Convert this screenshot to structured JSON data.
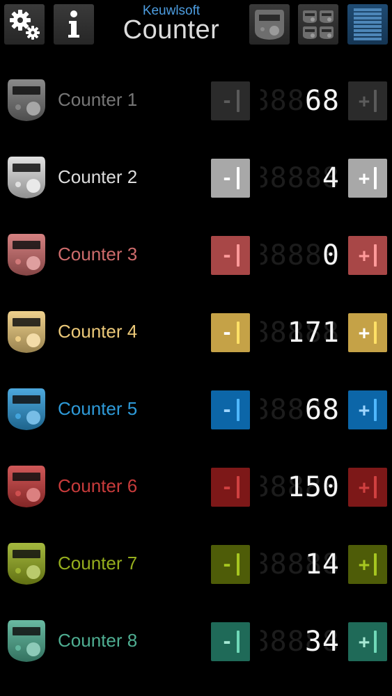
{
  "header": {
    "brand": "Keuwlsoft",
    "title": "Counter"
  },
  "toolbar": {
    "buttons": [
      {
        "icon": "gears-icon"
      },
      {
        "icon": "info-icon"
      },
      {
        "icon": "single-counter-icon"
      },
      {
        "icon": "multi-counter-icon"
      },
      {
        "icon": "list-icon"
      }
    ]
  },
  "counters": [
    {
      "name": "Counter 1",
      "value": "68",
      "color": "#777777",
      "button_color": "#2b2b2b",
      "bar_color": "#5a5a5a",
      "sign_color": "#5c5c5c"
    },
    {
      "name": "Counter 2",
      "value": "4",
      "color": "#dddddd",
      "button_color": "#a8a8a8",
      "bar_color": "#ffffff",
      "sign_color": "#ffffff"
    },
    {
      "name": "Counter 3",
      "value": "0",
      "color": "#cd6b6b",
      "button_color": "#a84747",
      "bar_color": "#ff9a9a",
      "sign_color": "#ff9a9a"
    },
    {
      "name": "Counter 4",
      "value": "171",
      "color": "#ecc979",
      "button_color": "#c5a247",
      "bar_color": "#ffe066",
      "sign_color": "#ffffff"
    },
    {
      "name": "Counter 5",
      "value": "68",
      "color": "#2e9ad8",
      "button_color": "#0c66a8",
      "bar_color": "#4fb8ff",
      "sign_color": "#9fd6ff"
    },
    {
      "name": "Counter 6",
      "value": "150",
      "color": "#c83b3b",
      "button_color": "#7d1818",
      "bar_color": "#d04040",
      "sign_color": "#d04040"
    },
    {
      "name": "Counter 7",
      "value": "14",
      "color": "#95ad1d",
      "button_color": "#4e5c08",
      "bar_color": "#a6c620",
      "sign_color": "#a6c620"
    },
    {
      "name": "Counter 8",
      "value": "34",
      "color": "#4fae92",
      "button_color": "#1f6a58",
      "bar_color": "#6fd8b8",
      "sign_color": "#a6e8d4"
    }
  ]
}
